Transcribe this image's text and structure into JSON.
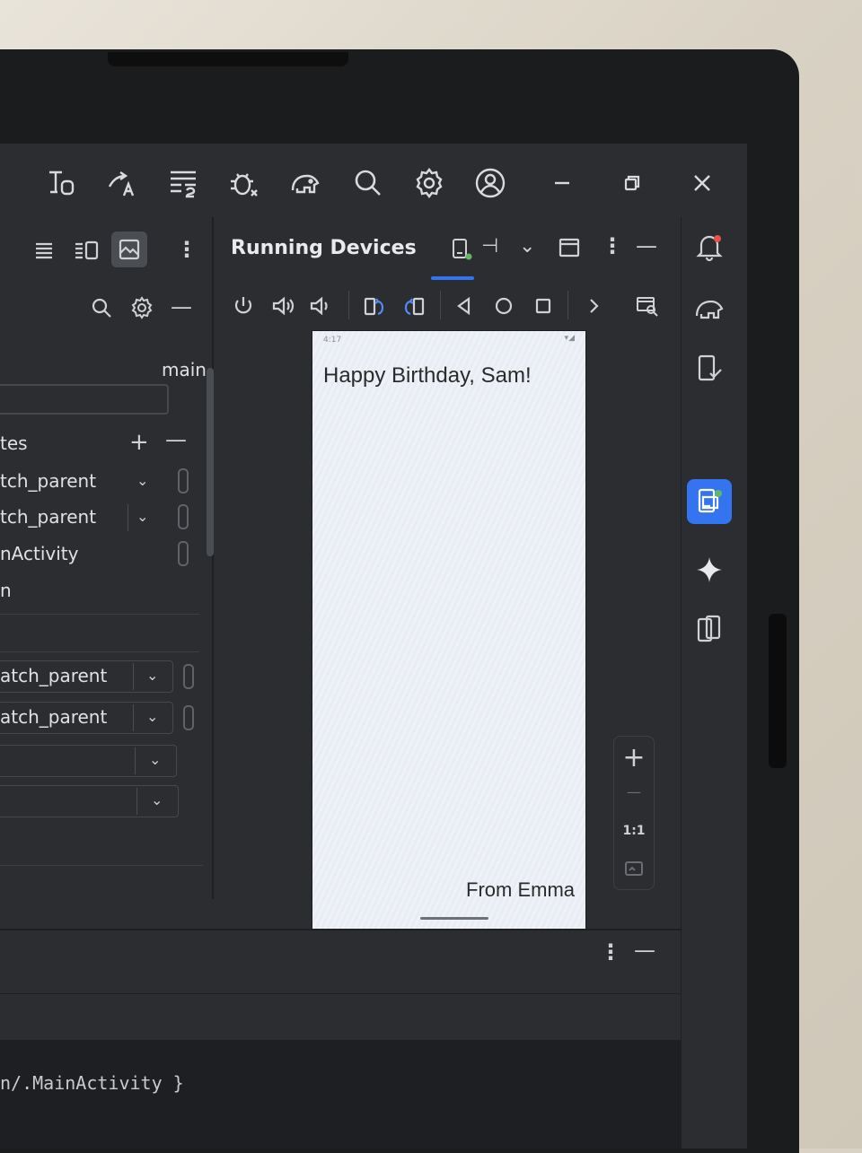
{
  "toolbar": {
    "icons": [
      "translate-icon",
      "translate-2-icon",
      "format-icon",
      "debug-icon",
      "elephant-icon",
      "search-icon",
      "gear-icon",
      "account-icon",
      "minimize-icon",
      "restore-icon",
      "close-icon"
    ]
  },
  "left_panel": {
    "branch_label": "main",
    "section_label_partial": "tes",
    "rows": [
      {
        "value": "tch_parent"
      },
      {
        "value": "tch_parent"
      },
      {
        "value": "nActivity"
      },
      {
        "value": "n"
      }
    ],
    "lower_rows": [
      {
        "value": "atch_parent"
      },
      {
        "value": "atch_parent"
      },
      {
        "value": ""
      },
      {
        "value": ""
      }
    ]
  },
  "running_devices": {
    "title": "Running Devices"
  },
  "zoom": {
    "plus": "+",
    "minus": "—",
    "one_to_one": "1:1"
  },
  "phone": {
    "status": "4:17",
    "greeting": "Happy Birthday, Sam!",
    "signature": "From Emma"
  },
  "console": {
    "line": "n/.MainActivity }"
  },
  "colors": {
    "accent": "#3574f0",
    "ide_bg": "#2b2d30",
    "console_bg": "#1e1f22"
  }
}
